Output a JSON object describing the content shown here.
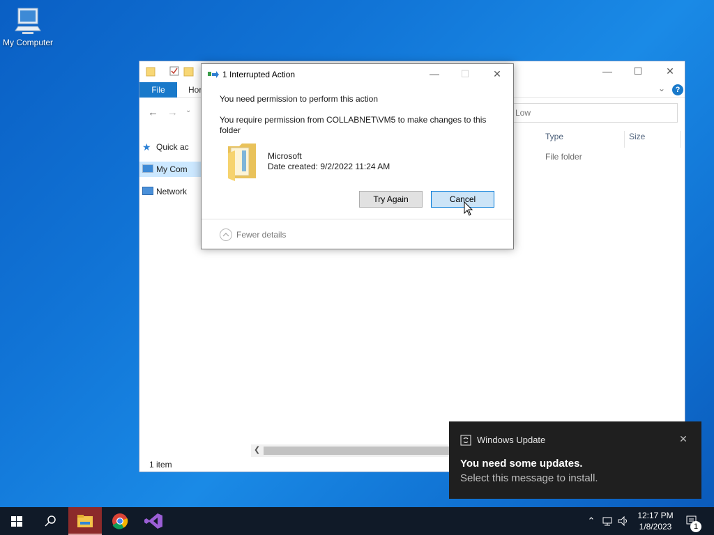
{
  "desktop": {
    "icon_label": "My Computer"
  },
  "explorer": {
    "ribbon": {
      "file_tab": "File",
      "home_tab": "Hor"
    },
    "search_placeholder": "Low",
    "nav": [
      {
        "label": "Quick ac"
      },
      {
        "label": "My Com"
      },
      {
        "label": "Network"
      }
    ],
    "columns": {
      "type": "Type",
      "size": "Size"
    },
    "row": {
      "type": "File folder"
    },
    "status": "1 item"
  },
  "dialog": {
    "title": "1 Interrupted Action",
    "heading": "You need permission to perform this action",
    "message": "You require permission from COLLABNET\\VM5 to make changes to this folder",
    "folder_name": "Microsoft",
    "folder_date": "Date created: 9/2/2022 11:24 AM",
    "try_again": "Try Again",
    "cancel": "Cancel",
    "fewer_details": "Fewer details"
  },
  "toast": {
    "app": "Windows Update",
    "title": "You need some updates.",
    "message": "Select this message to install."
  },
  "taskbar": {
    "time": "12:17 PM",
    "date": "1/8/2023",
    "notification_count": "1"
  },
  "colors": {
    "accent": "#0078d7",
    "file_tab": "#1979ca",
    "taskbar": "#101a28",
    "toast_bg": "#1f1f1f"
  }
}
